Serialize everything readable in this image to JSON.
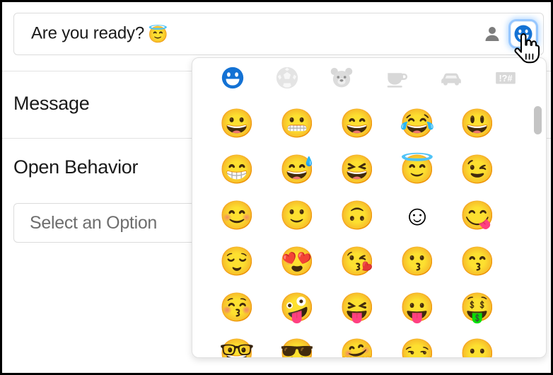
{
  "message_input": {
    "value": "Are you ready?",
    "trailing_emoji": "😇",
    "person_icon": "person-icon",
    "emoji_toggle_icon": "smiley-face-icon"
  },
  "form": {
    "message_label": "Message",
    "open_behavior_label": "Open Behavior",
    "select_placeholder": "Select an Option"
  },
  "emoji_picker": {
    "active_tab_color": "#1472d4",
    "inactive_tab_color": "#d6d6d6",
    "tabs": [
      {
        "name": "smileys-people",
        "icon": "smiley-face-icon",
        "active": true
      },
      {
        "name": "activities",
        "icon": "soccer-ball-icon",
        "active": false
      },
      {
        "name": "animals-nature",
        "icon": "bear-face-icon",
        "active": false
      },
      {
        "name": "food-drink",
        "icon": "coffee-cup-icon",
        "active": false
      },
      {
        "name": "travel-places",
        "icon": "car-icon",
        "active": false
      },
      {
        "name": "symbols",
        "icon": "symbols-icon",
        "label": "!?#",
        "active": false
      }
    ],
    "rows": [
      {
        "emojis": [
          "😀",
          "😬",
          "😄",
          "😂",
          "😃"
        ]
      },
      {
        "emojis": [
          "😁",
          "😅",
          "😆",
          "😇",
          "😉"
        ]
      },
      {
        "emojis": [
          "😊",
          "🙂",
          "🙃",
          "☺",
          "😋"
        ]
      },
      {
        "emojis": [
          "😌",
          "😍",
          "😘",
          "😗",
          "😙"
        ]
      },
      {
        "emojis": [
          "😚",
          "🤪",
          "😝",
          "😛",
          "🤑"
        ]
      },
      {
        "emojis": [
          "🤓",
          "😎",
          "🤗",
          "😏",
          "😶"
        ]
      }
    ],
    "scrollbar": {
      "name": "vertical-scrollbar"
    }
  },
  "cursor": {
    "type": "pointing-hand-cursor"
  }
}
